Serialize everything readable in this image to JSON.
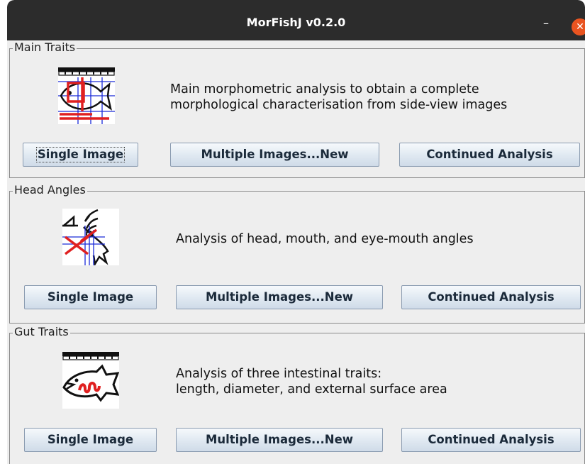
{
  "window": {
    "title": "MorFishJ v0.2.0",
    "minimize_glyph": "–",
    "close_glyph": "✕"
  },
  "sections": [
    {
      "legend": "Main Traits",
      "icon": "fish-ruler-icon",
      "description_lines": [
        "Main morphometric analysis to obtain a complete",
        "morphological characterisation from side-view images"
      ],
      "buttons": [
        "Single Image",
        "Multiple Images...New",
        "Continued Analysis"
      ]
    },
    {
      "legend": "Head Angles",
      "icon": "head-angles-icon",
      "description_lines": [
        "Analysis of head, mouth, and eye-mouth angles"
      ],
      "buttons": [
        "Single Image",
        "Multiple Images...New",
        "Continued Analysis"
      ]
    },
    {
      "legend": "Gut Traits",
      "icon": "fish-gut-icon",
      "description_lines": [
        "Analysis of three intestinal traits:",
        "length, diameter, and external surface area"
      ],
      "buttons": [
        "Single Image",
        "Multiple Images...New",
        "Continued Analysis"
      ]
    }
  ],
  "colors": {
    "titlebar": "#2c2c2c",
    "close": "#e95420",
    "window_bg": "#eeeeee",
    "icon_red": "#e02020",
    "icon_blue": "#1a2ad8"
  }
}
